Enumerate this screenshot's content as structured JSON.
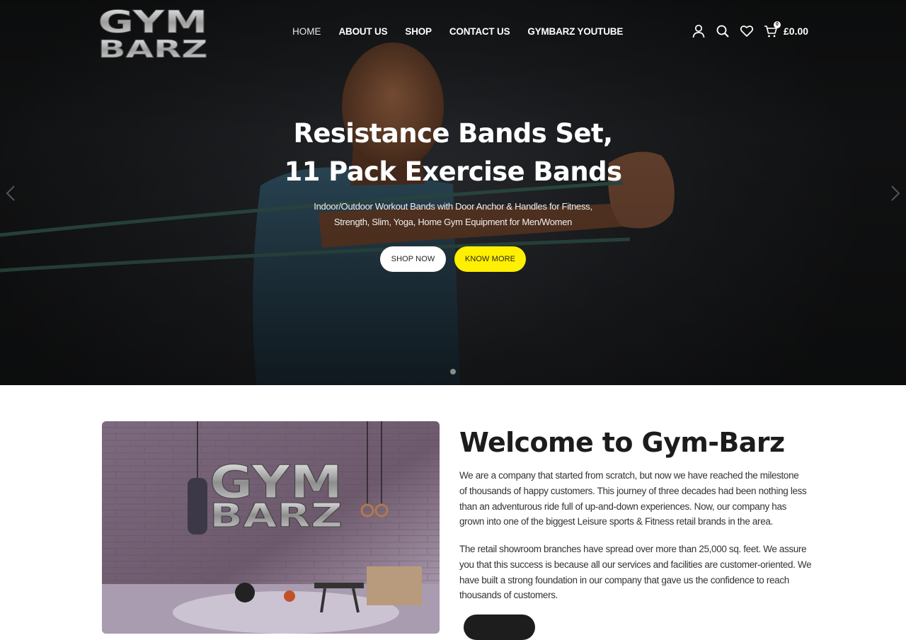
{
  "brand": {
    "logo_line1": "GYM",
    "logo_line2": "BARZ"
  },
  "nav": {
    "items": [
      {
        "label": "HOME"
      },
      {
        "label": "ABOUT US"
      },
      {
        "label": "SHOP"
      },
      {
        "label": "CONTACT US"
      },
      {
        "label": "GYMBARZ YOUTUBE"
      }
    ]
  },
  "header": {
    "icons": [
      "user-icon",
      "search-icon",
      "heart-icon",
      "cart-icon"
    ],
    "cart_count": "0",
    "cart_total": "£0.00"
  },
  "hero": {
    "title_line1": "Resistance Bands Set,",
    "title_line2": "11 Pack Exercise Bands",
    "subtitle_line1": "Indoor/Outdoor Workout Bands with Door Anchor & Handles for Fitness,",
    "subtitle_line2": "Strength, Slim, Yoga, Home Gym Equipment for Men/Women",
    "shop_button": "SHOP NOW",
    "know_button": "KNOW MORE",
    "colors": {
      "accent": "#ffef00",
      "overlay": "#1d1f22"
    }
  },
  "welcome": {
    "title": "Welcome to Gym-Barz",
    "paragraph1": [
      "We are a company that started from scratch, but now we have reached the milestone",
      "of thousands of happy customers. This journey of three decades had been nothing less",
      "than an adventurous ride full of up-and-down experiences. Now, our company has",
      "grown into one of the biggest Leisure sports & Fitness retail brands in the area."
    ],
    "paragraph2": [
      "The retail showroom branches have spread over more than 25,000 sq. feet. We assure",
      "you that this success is because all our services and facilities are customer-oriented. We",
      "have built a strong foundation in our company that gave us the confidence to reach",
      "thousands of customers."
    ]
  }
}
